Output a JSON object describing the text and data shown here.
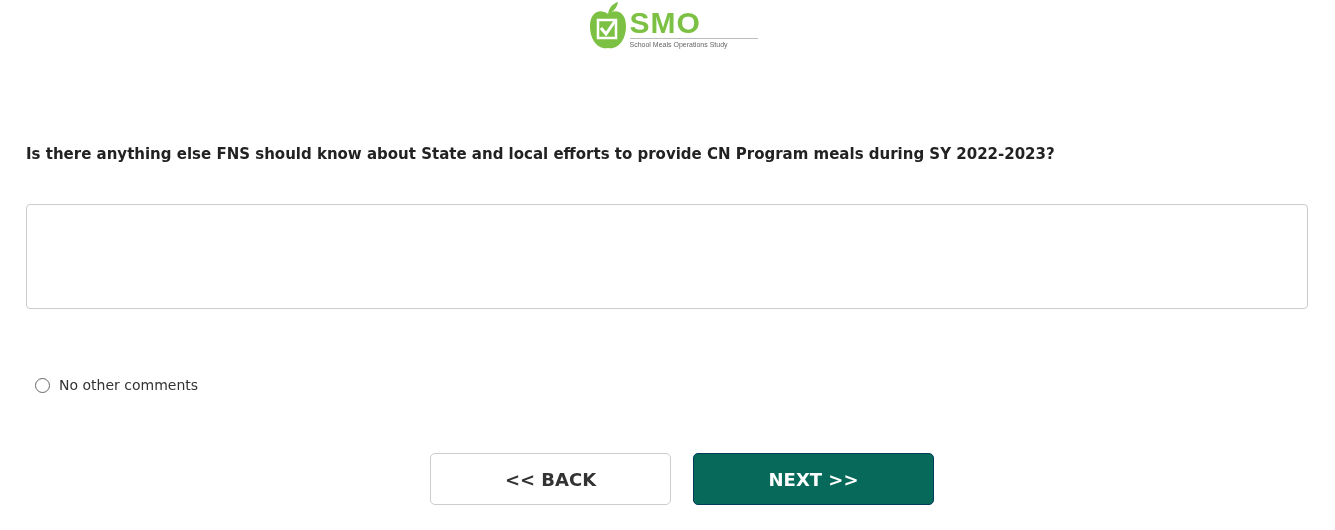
{
  "logo": {
    "title": "SMO",
    "subtitle": "School Meals Operations Study"
  },
  "question": "Is there anything else FNS should know about State and local efforts to provide CN Program meals during SY 2022-2023?",
  "options": [
    {
      "label": "No other comments",
      "selected": false
    }
  ],
  "buttons": [
    {
      "label": "<< BACK",
      "kind": "secondary"
    },
    {
      "label": "NEXT >>",
      "kind": "primary"
    }
  ]
}
